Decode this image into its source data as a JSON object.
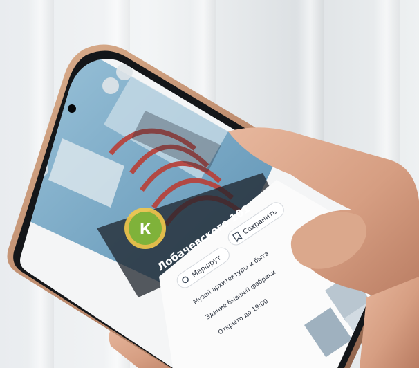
{
  "photo": {
    "subject": "hand-holding-smartphone",
    "phone_color": "#c99775",
    "background_color": "#e8ecee"
  },
  "screen": {
    "header_title": "Лобачевского 101",
    "buttons": [
      {
        "label": "Маршрут",
        "icon": "route-icon"
      },
      {
        "label": "Сохранить",
        "icon": "bookmark-icon"
      }
    ],
    "map_marker": {
      "letter": "К",
      "color": "#7fb23a"
    },
    "list_lines": [
      "Музей архитектуры и быта",
      "Здание бывшей фабрики",
      "Открыто до 19:00"
    ]
  }
}
